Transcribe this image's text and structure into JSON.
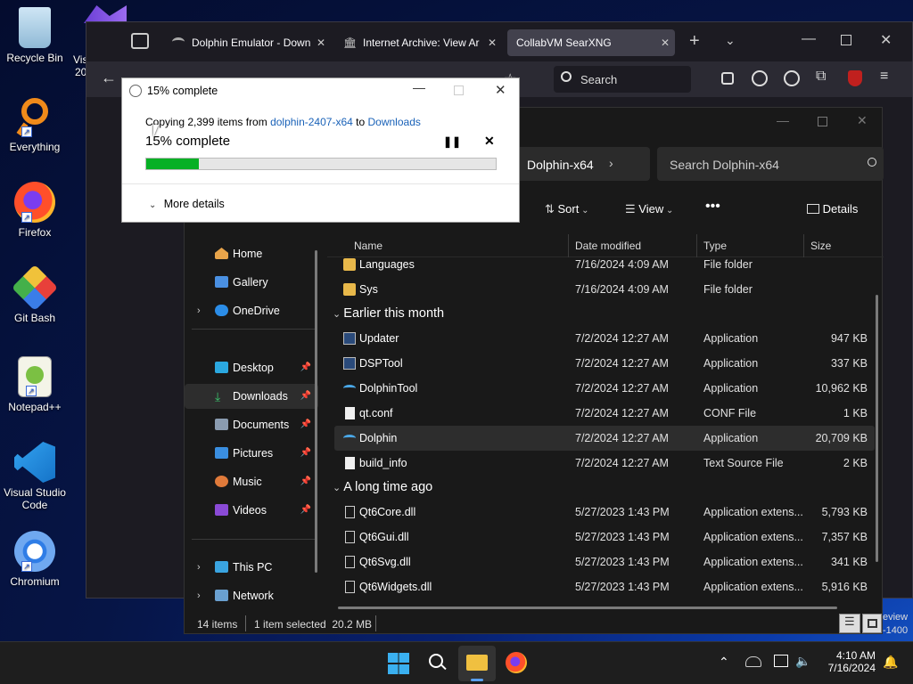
{
  "desktop": {
    "icons": [
      {
        "label": "Recycle Bin"
      },
      {
        "label": "Everything"
      },
      {
        "label": "Firefox"
      },
      {
        "label": "Git Bash"
      },
      {
        "label": "Notepad++"
      },
      {
        "label": "Visual Studio Code"
      },
      {
        "label": "Chromium"
      }
    ],
    "partial_vis": "Vis",
    "partial_20": "20",
    "watermark_line1": "eview",
    "watermark_line2": "-1400"
  },
  "firefox": {
    "tabs": [
      {
        "label": "Dolphin Emulator - Down"
      },
      {
        "label": "Internet Archive: View Ar"
      },
      {
        "label": "CollabVM SearXNG"
      }
    ],
    "search_placeholder": "Search"
  },
  "copy_dialog": {
    "title": "15% complete",
    "message_prefix": "Copying 2,399 items from ",
    "source": "dolphin-2407-x64",
    "message_mid": " to ",
    "destination": "Downloads",
    "progress_label": "15% complete",
    "progress_percent": 15,
    "more_details": "More details"
  },
  "explorer": {
    "breadcrumb": "Dolphin-x64",
    "search_placeholder": "Search Dolphin-x64",
    "sort_label": "Sort",
    "view_label": "View",
    "details_label": "Details",
    "columns": {
      "name": "Name",
      "date": "Date modified",
      "type": "Type",
      "size": "Size"
    },
    "nav": {
      "home": "Home",
      "gallery": "Gallery",
      "onedrive": "OneDrive",
      "desktop": "Desktop",
      "downloads": "Downloads",
      "documents": "Documents",
      "pictures": "Pictures",
      "music": "Music",
      "videos": "Videos",
      "thispc": "This PC",
      "network": "Network"
    },
    "groups": {
      "earlier": "Earlier this month",
      "longago": "A long time ago"
    },
    "files_top": [
      {
        "name": "Languages",
        "date": "7/16/2024 4:09 AM",
        "type": "File folder",
        "size": ""
      },
      {
        "name": "Sys",
        "date": "7/16/2024 4:09 AM",
        "type": "File folder",
        "size": ""
      }
    ],
    "files_earlier": [
      {
        "name": "Updater",
        "date": "7/2/2024 12:27 AM",
        "type": "Application",
        "size": "947 KB"
      },
      {
        "name": "DSPTool",
        "date": "7/2/2024 12:27 AM",
        "type": "Application",
        "size": "337 KB"
      },
      {
        "name": "DolphinTool",
        "date": "7/2/2024 12:27 AM",
        "type": "Application",
        "size": "10,962 KB"
      },
      {
        "name": "qt.conf",
        "date": "7/2/2024 12:27 AM",
        "type": "CONF File",
        "size": "1 KB"
      },
      {
        "name": "Dolphin",
        "date": "7/2/2024 12:27 AM",
        "type": "Application",
        "size": "20,709 KB"
      },
      {
        "name": "build_info",
        "date": "7/2/2024 12:27 AM",
        "type": "Text Source File",
        "size": "2 KB"
      }
    ],
    "files_longago": [
      {
        "name": "Qt6Core.dll",
        "date": "5/27/2023 1:43 PM",
        "type": "Application extens...",
        "size": "5,793 KB"
      },
      {
        "name": "Qt6Gui.dll",
        "date": "5/27/2023 1:43 PM",
        "type": "Application extens...",
        "size": "7,357 KB"
      },
      {
        "name": "Qt6Svg.dll",
        "date": "5/27/2023 1:43 PM",
        "type": "Application extens...",
        "size": "341 KB"
      },
      {
        "name": "Qt6Widgets.dll",
        "date": "5/27/2023 1:43 PM",
        "type": "Application extens...",
        "size": "5,916 KB"
      }
    ],
    "status": {
      "count": "14 items",
      "selected": "1 item selected  20.2 MB"
    }
  },
  "taskbar": {
    "time": "4:10 AM",
    "date": "7/16/2024"
  },
  "colors": {
    "accent": "#0078d4",
    "progress": "#06b025",
    "link": "#1a62b8"
  }
}
